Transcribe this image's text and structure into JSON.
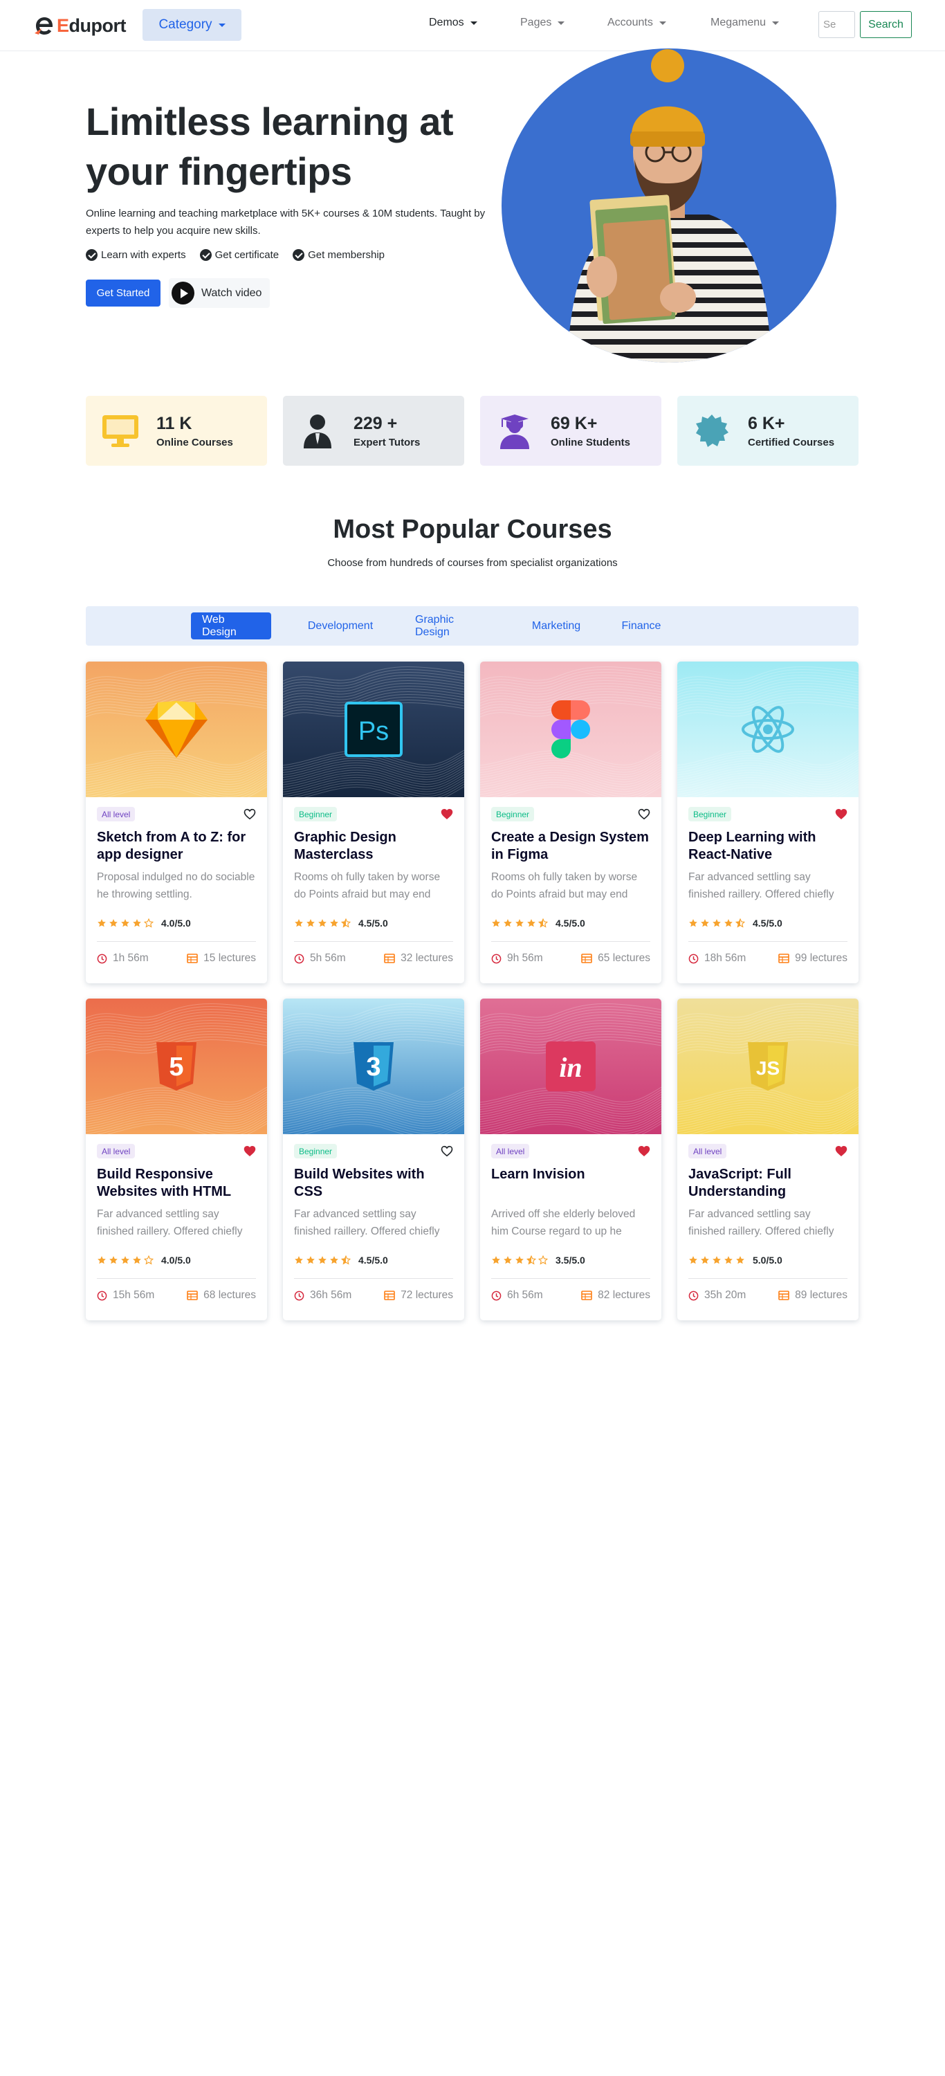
{
  "header": {
    "logo_prefix": "E",
    "logo_suffix": "duport",
    "category_label": "Category",
    "menu": [
      {
        "label": "Demos",
        "active": true
      },
      {
        "label": "Pages",
        "active": false
      },
      {
        "label": "Accounts",
        "active": false
      },
      {
        "label": "Megamenu",
        "active": false
      }
    ],
    "search_placeholder": "Se",
    "search_button": "Search"
  },
  "hero": {
    "title": "Limitless learning at your fingertips",
    "description": "Online learning and teaching marketplace with 5K+ courses & 10M students. Taught by experts to help you acquire new skills.",
    "features": [
      "Learn with experts",
      "Get certificate",
      "Get membership"
    ],
    "cta_primary": "Get Started",
    "cta_video": "Watch video",
    "circle_color": "#3a6fcf"
  },
  "counters": [
    {
      "value": "11 K",
      "label": "Online Courses",
      "icon": "tv-icon",
      "bg": "#fef6e1",
      "color": "#f7c32e"
    },
    {
      "value": "229 +",
      "label": "Expert Tutors",
      "icon": "user-tie-icon",
      "bg": "#e7eaed",
      "color": "#24292d"
    },
    {
      "value": "69 K+",
      "label": "Online Students",
      "icon": "graduation-cap-icon",
      "bg": "#f0ecf9",
      "color": "#6f42c1"
    },
    {
      "value": "6 K+",
      "label": "Certified Courses",
      "icon": "certificate-badge-icon",
      "bg": "#e6f5f7",
      "color": "#4aa3b6"
    }
  ],
  "popular": {
    "title": "Most Popular Courses",
    "subtitle": "Choose from hundreds of courses from specialist organizations",
    "tabs": [
      {
        "label": "Web Design",
        "active": true
      },
      {
        "label": "Development",
        "active": false
      },
      {
        "label": "Graphic Design",
        "active": false
      },
      {
        "label": "Marketing",
        "active": false
      },
      {
        "label": "Finance",
        "active": false
      }
    ]
  },
  "courses": [
    {
      "level": "All level",
      "level_type": "all",
      "favorite": false,
      "title": "Sketch from A to Z: for app designer",
      "desc": "Proposal indulged no do sociable he throwing settling.",
      "stars": 4,
      "rating": "4.0/5.0",
      "duration": "1h 56m",
      "lectures": "15 lectures",
      "icon": "sketch-icon",
      "bg1": "#f3a564",
      "bg2": "#f9d07c"
    },
    {
      "level": "Beginner",
      "level_type": "beg",
      "favorite": true,
      "title": "Graphic Design Masterclass",
      "desc": "Rooms oh fully taken by worse do Points afraid but may end",
      "stars": 4.5,
      "rating": "4.5/5.0",
      "duration": "5h 56m",
      "lectures": "32 lectures",
      "icon": "photoshop-icon",
      "bg1": "#34496b",
      "bg2": "#15263f"
    },
    {
      "level": "Beginner",
      "level_type": "beg",
      "favorite": false,
      "title": "Create a Design System in Figma",
      "desc": "Rooms oh fully taken by worse do Points afraid but may end",
      "stars": 4.5,
      "rating": "4.5/5.0",
      "duration": "9h 56m",
      "lectures": "65 lectures",
      "icon": "figma-icon",
      "bg1": "#f3b8c0",
      "bg2": "#f9d4d8"
    },
    {
      "level": "Beginner",
      "level_type": "beg",
      "favorite": true,
      "title": "Deep Learning with React-Native",
      "desc": "Far advanced settling say finished raillery. Offered chiefly",
      "stars": 4.5,
      "rating": "4.5/5.0",
      "duration": "18h 56m",
      "lectures": "99 lectures",
      "icon": "react-icon",
      "bg1": "#9eeaf4",
      "bg2": "#dff8fb"
    },
    {
      "level": "All level",
      "level_type": "all",
      "favorite": true,
      "title": "Build Responsive Websites with HTML",
      "desc": "Far advanced settling say finished raillery. Offered chiefly",
      "stars": 4,
      "rating": "4.0/5.0",
      "duration": "15h 56m",
      "lectures": "68 lectures",
      "icon": "html5-icon",
      "bg1": "#ec6d4c",
      "bg2": "#f5a45c"
    },
    {
      "level": "Beginner",
      "level_type": "beg",
      "favorite": false,
      "title": "Build Websites with CSS",
      "desc": "Far advanced settling say finished raillery. Offered chiefly",
      "stars": 4.5,
      "rating": "4.5/5.0",
      "duration": "36h 56m",
      "lectures": "72 lectures",
      "icon": "css3-icon",
      "bg1": "#b8e6f5",
      "bg2": "#3b86c4"
    },
    {
      "level": "All level",
      "level_type": "all",
      "favorite": true,
      "title": "Learn Invision",
      "desc": "Arrived off she elderly beloved him Course regard to up he hardly.",
      "stars": 3.5,
      "rating": "3.5/5.0",
      "duration": "6h 56m",
      "lectures": "82 lectures",
      "icon": "invision-icon",
      "bg1": "#e06f95",
      "bg2": "#c93a73"
    },
    {
      "level": "All level",
      "level_type": "all",
      "favorite": true,
      "title": "JavaScript: Full Understanding",
      "desc": "Far advanced settling say finished raillery. Offered chiefly",
      "stars": 5,
      "rating": "5.0/5.0",
      "duration": "35h 20m",
      "lectures": "89 lectures",
      "icon": "javascript-icon",
      "bg1": "#f0df9a",
      "bg2": "#f5d657"
    }
  ]
}
